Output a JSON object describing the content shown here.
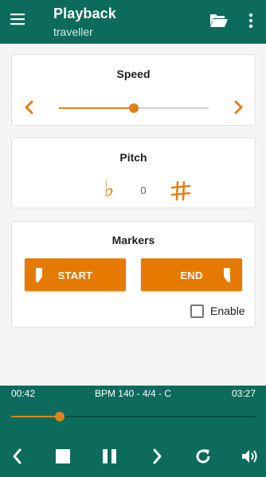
{
  "appbar": {
    "title": "Playback",
    "subtitle": "traveller",
    "menu_icon": "hamburger-menu-icon",
    "open_icon": "folder-open-icon",
    "more_icon": "more-vert-icon"
  },
  "speed": {
    "title": "Speed",
    "slider_fraction": 0.5
  },
  "pitch": {
    "title": "Pitch",
    "flat_symbol": "♭",
    "value": "0",
    "sharp_icon": "sharp-icon"
  },
  "markers": {
    "title": "Markers",
    "start_label": "START",
    "end_label": "END",
    "enable_label": "Enable",
    "enable_checked": false
  },
  "player": {
    "current_time": "00:42",
    "info": "BPM 140 - 4/4 - C",
    "total_time": "03:27",
    "progress_fraction": 0.2,
    "controls": [
      "previous-icon",
      "stop-icon",
      "pause-icon",
      "next-icon",
      "repeat-icon",
      "volume-icon"
    ]
  },
  "colors": {
    "primary": "#0c6b5b",
    "accent": "#e0821a",
    "button": "#e67a00"
  }
}
